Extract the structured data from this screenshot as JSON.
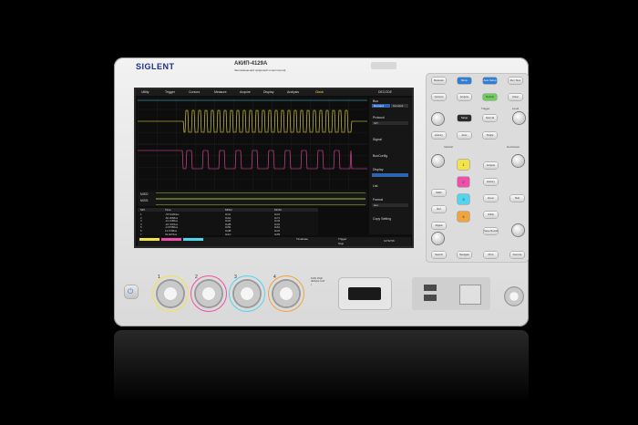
{
  "brand": {
    "logo": "SIGLENT",
    "model": "АКИП-4129А",
    "subtitle": "Запоминающий цифровой осциллограф"
  },
  "screen": {
    "menu": [
      "Utility",
      "Trigger",
      "Cursors",
      "Measure",
      "Acquire",
      "Display",
      "Analysis"
    ],
    "clock": "Clock",
    "decode": "DECODE",
    "sidebar": {
      "bus": "Bus",
      "bus_tabs": [
        "Decode1",
        "Decode2"
      ],
      "protocol": "Protocol",
      "protocol_value": "SPI",
      "signal": "Signal",
      "busconfig": "BusConfig",
      "display": "Display",
      "list": "List",
      "format": "Format",
      "format_value": "Hex",
      "copy_setting": "Copy Setting"
    },
    "decode_table": {
      "headers": [
        "SPI",
        "Time",
        "MISO",
        "MOSI"
      ],
      "rows": [
        [
          "1",
          "-78.61364us",
          "0x41",
          "0x31"
        ],
        [
          "2",
          "-60.2068us",
          "0x6A",
          "0x71"
        ],
        [
          "3",
          "-41.4180us",
          "0x32",
          "0x43"
        ],
        [
          "4",
          "-22.7215us",
          "0x2B",
          "0x01"
        ],
        [
          "5",
          "-3.97080us",
          "0x59",
          "0x61"
        ],
        [
          "6",
          "14.6708us",
          "0x4B",
          "0x31"
        ],
        [
          "7",
          "33.4076us",
          "0x1C",
          "0x55"
        ]
      ]
    },
    "bus_labels": [
      "MISO",
      "MOSI"
    ],
    "status": {
      "timebase": "Timebase",
      "trigger": "Trigger",
      "stop": "Stop",
      "time": "14:52:56"
    }
  },
  "panel_buttons": {
    "top_row": [
      "Measure",
      "Menu",
      "Auto Setup",
      "Run Stop"
    ],
    "second_row": [
      "Cursors",
      "Acquire",
      "Default",
      "Clear Sweeps"
    ],
    "trigger": [
      "Setup",
      "Auto",
      "Normal",
      "Single"
    ],
    "labels": {
      "trigger": "Trigger",
      "level": "Level",
      "vertical": "Vertical",
      "horizontal": "Horizontal"
    },
    "channels": [
      "1",
      "2",
      "3",
      "4"
    ],
    "left_column": [
      "Math",
      "Ref",
      "Digital"
    ],
    "right_column": [
      "Acquire",
      "History",
      "Zoom",
      "Roll",
      "Utility",
      "Save Recall"
    ],
    "bottom": [
      "Search",
      "Navigate",
      "Print",
      "Decode"
    ]
  },
  "front": {
    "channel_numbers": [
      "1",
      "2",
      "3",
      "4"
    ],
    "input_spec": "1MΩ 15pF 400Vpk CAT I",
    "colors": {
      "ch1": "#f3e34a",
      "ch2": "#ef4fa8",
      "ch3": "#4fd5ef",
      "ch4": "#f1a43a",
      "logo": "#1c2f8a"
    }
  }
}
